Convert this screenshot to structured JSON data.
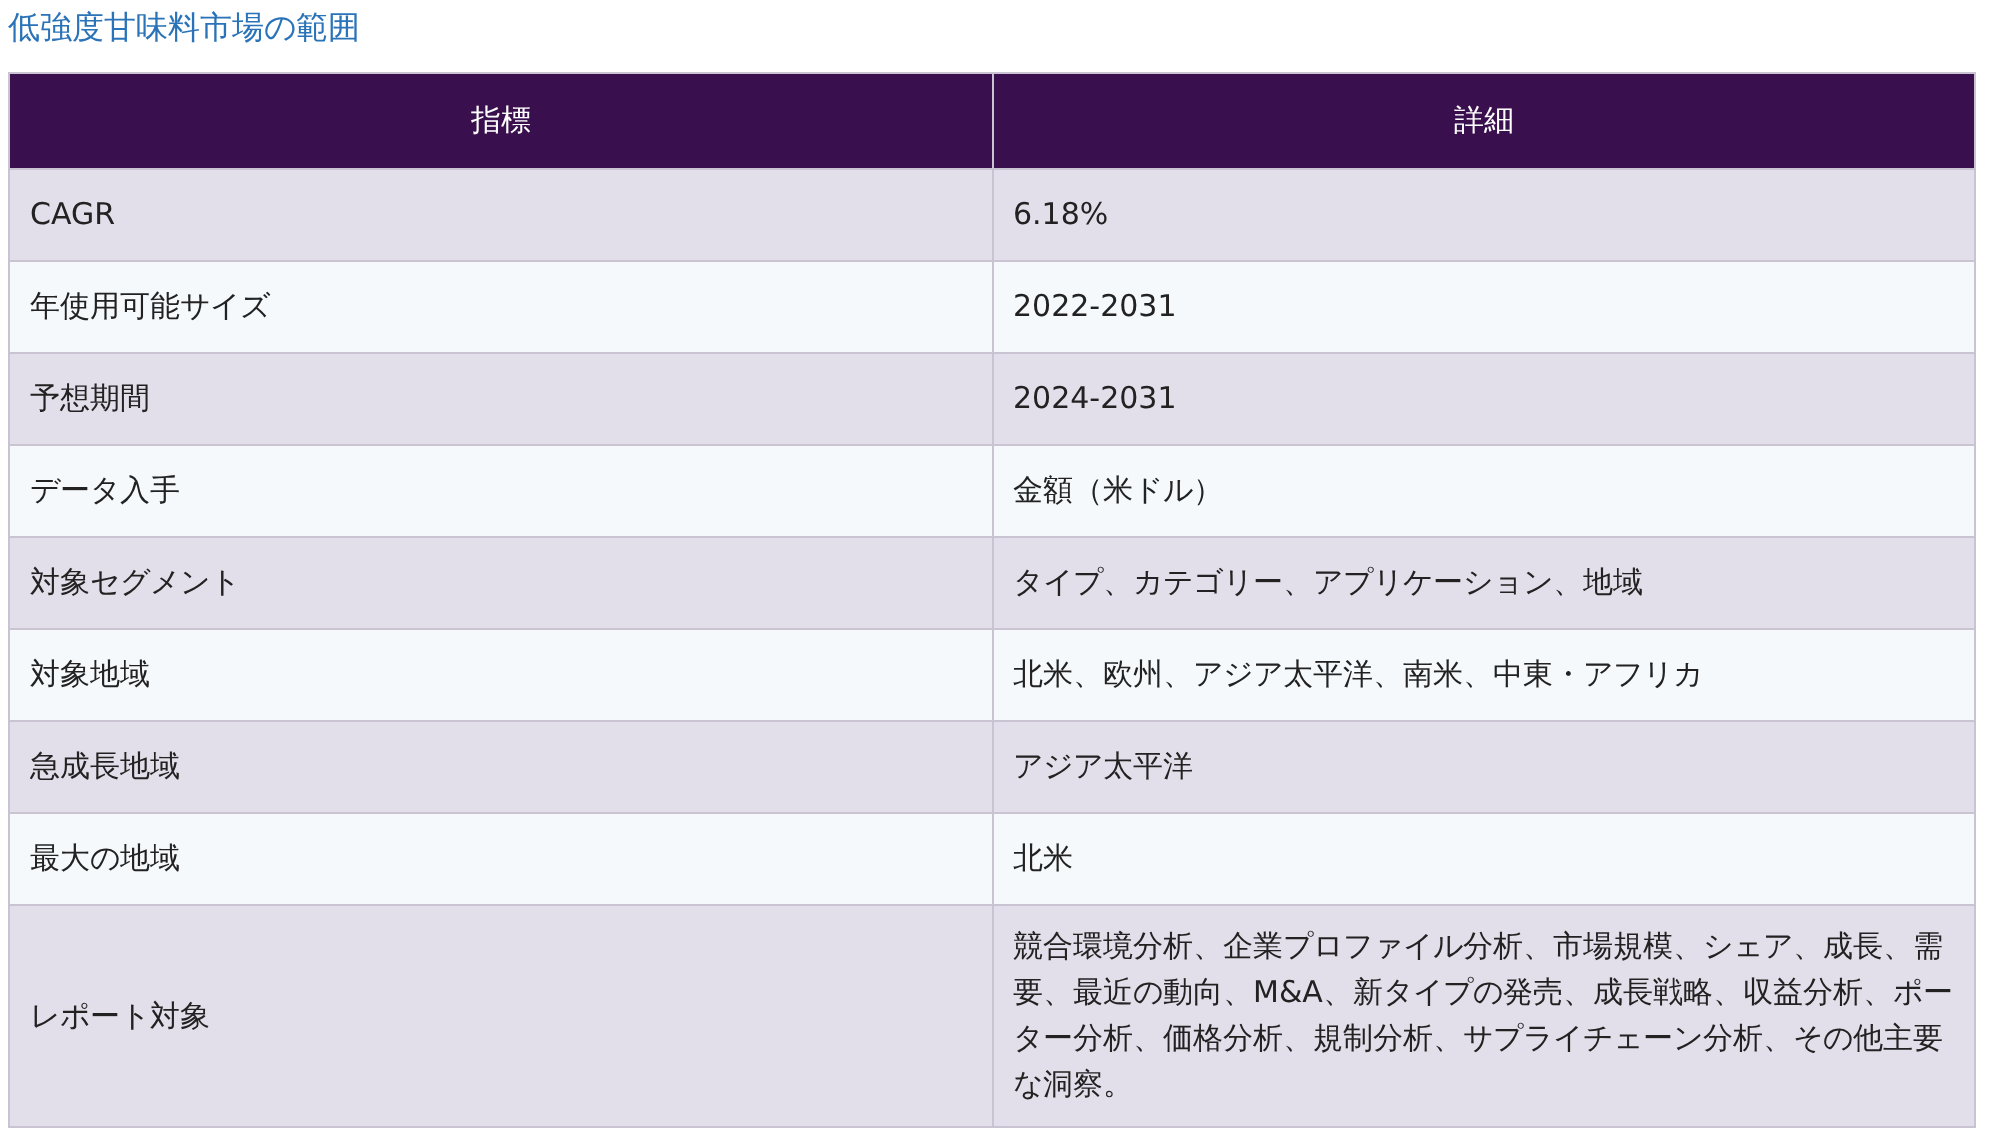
{
  "title": "低強度甘味料市場の範囲",
  "table": {
    "columns": [
      "指標",
      "詳細"
    ],
    "rows": [
      [
        "CAGR",
        "6.18%"
      ],
      [
        "年使用可能サイズ",
        "2022-2031"
      ],
      [
        "予想期間",
        "2024-2031"
      ],
      [
        "データ入手",
        "金額（米ドル）"
      ],
      [
        "対象セグメント",
        "タイプ、カテゴリー、アプリケーション、地域"
      ],
      [
        "対象地域",
        "北米、欧州、アジア太平洋、南米、中東・アフリカ"
      ],
      [
        "急成長地域",
        "アジア太平洋"
      ],
      [
        "最大の地域",
        "北米"
      ],
      [
        "レポート対象",
        "競合環境分析、企業プロファイル分析、市場規模、シェア、成長、需要、最近の動向、M&A、新タイプの発売、成長戦略、収益分析、ポーター分析、価格分析、規制分析、サプライチェーン分析、その他主要な洞察。"
      ]
    ]
  }
}
